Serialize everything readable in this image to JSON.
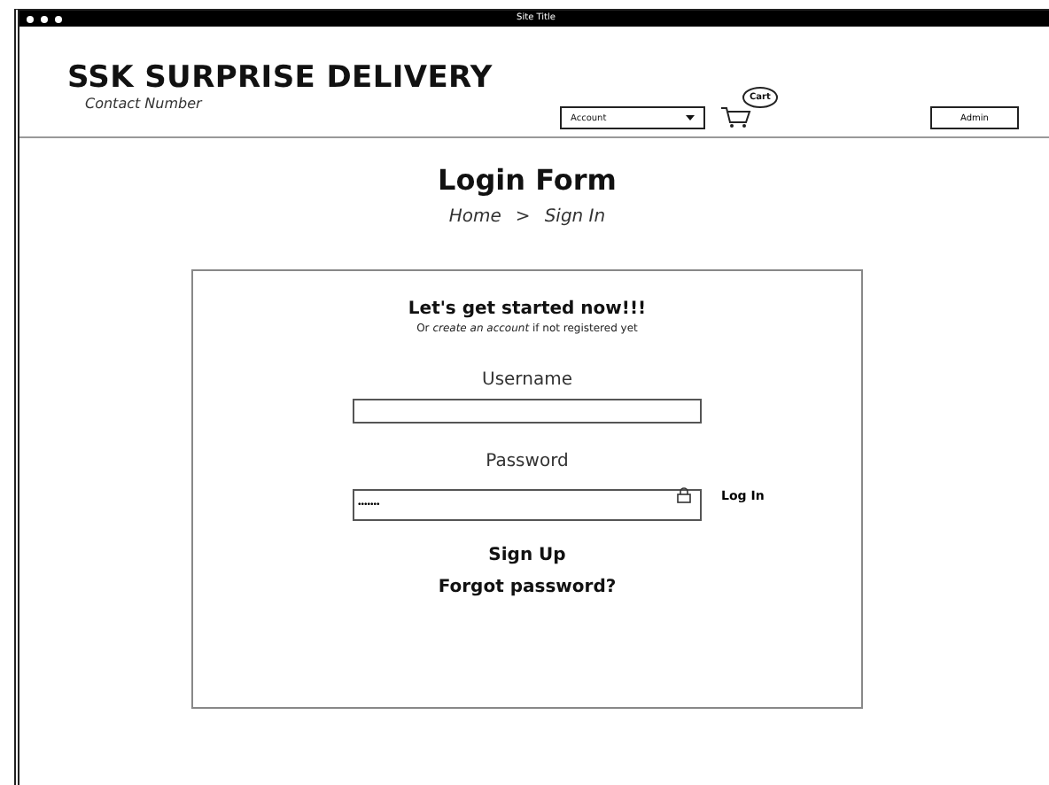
{
  "window": {
    "title": "Site Title"
  },
  "header": {
    "brand": "SSK SURPRISE DELIVERY",
    "contact": "Contact Number",
    "account_select": {
      "value": "Account"
    },
    "cart": {
      "label": "Cart"
    },
    "admin_button": "Admin"
  },
  "page": {
    "title": "Login Form",
    "breadcrumb": [
      {
        "label": "Home"
      },
      {
        "label": ">"
      },
      {
        "label": "Sign In"
      }
    ]
  },
  "form": {
    "heading": "Let's get started now!!!",
    "subheading": "Or *create an account* if not registered yet",
    "username": {
      "label": "Username"
    },
    "password": {
      "label": "Password",
      "value": "•••••••"
    },
    "login_button": "Log In",
    "signup_link": "Sign Up",
    "forgot_link": "Forgot password?"
  }
}
